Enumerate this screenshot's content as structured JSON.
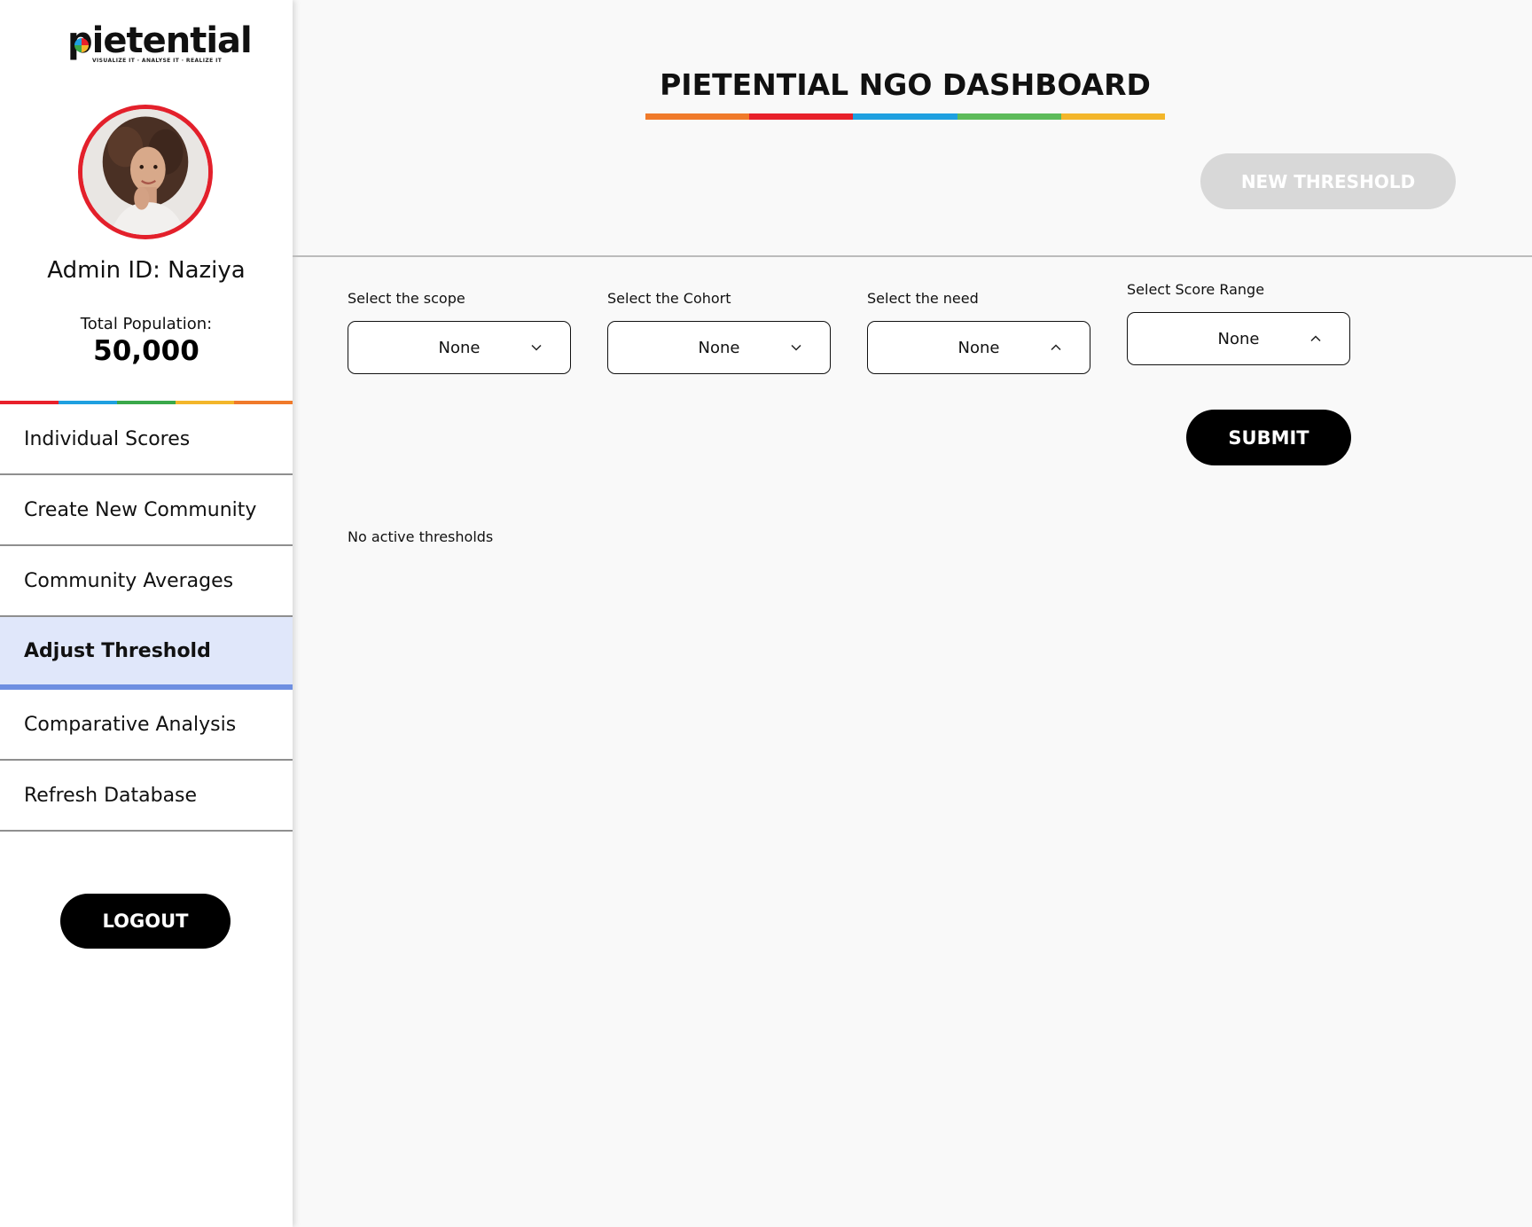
{
  "brand": {
    "logo_text": "pietential",
    "tagline": "VISUALIZE IT · ANALYSE IT · REALIZE IT",
    "rainbow_colors": [
      "#e8202a",
      "#1ea0e0",
      "#3aa84a",
      "#f3b62a",
      "#f07a2a"
    ]
  },
  "sidebar": {
    "admin_label": "Admin ID: Naziya",
    "population_label": "Total Population:",
    "population_value": "50,000",
    "items": [
      {
        "label": "Individual Scores",
        "active": false
      },
      {
        "label": "Create New Community",
        "active": false
      },
      {
        "label": "Community Averages",
        "active": false
      },
      {
        "label": "Adjust Threshold",
        "active": true
      },
      {
        "label": "Comparative Analysis",
        "active": false
      },
      {
        "label": "Refresh Database",
        "active": false
      }
    ],
    "logout_label": "LOGOUT"
  },
  "header": {
    "title": "PIETENTIAL NGO DASHBOARD",
    "title_underline_colors": [
      "#f07a2a",
      "#e8202a",
      "#1ea0e0",
      "#5dbb5a",
      "#f3b62a"
    ],
    "new_threshold_label": "NEW THRESHOLD"
  },
  "filters": {
    "scope": {
      "label": "Select the scope",
      "value": "None",
      "caret": "chevron-down-icon"
    },
    "cohort": {
      "label": "Select the Cohort",
      "value": "None",
      "caret": "chevron-down-icon"
    },
    "need": {
      "label": "Select the need",
      "value": "None",
      "caret": "chevron-up-icon"
    },
    "score_range": {
      "label": "Select Score Range",
      "value": "None",
      "caret": "chevron-up-icon"
    }
  },
  "submit_label": "SUBMIT",
  "status_text": "No active thresholds",
  "colors": {
    "active_nav_bg": "#e0e7fa",
    "active_nav_underline": "#6e8fe1",
    "avatar_ring": "#e3202b",
    "disabled_button": "#d8d8d8"
  }
}
